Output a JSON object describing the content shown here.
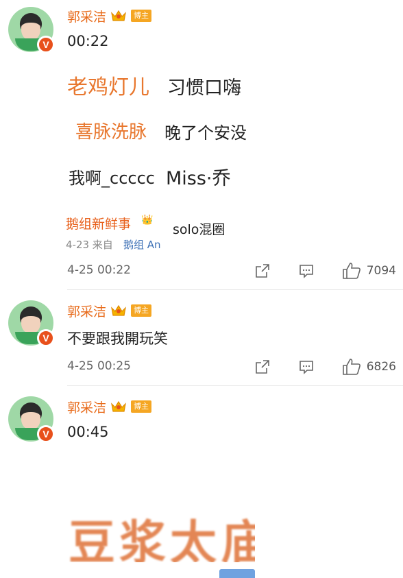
{
  "posts": [
    {
      "user": {
        "name": "郭采洁",
        "tag": "博主"
      },
      "text": "00:22",
      "embedded": {
        "line1_name": "老鸡灯儿",
        "line1_text": "习惯口嗨",
        "line2_name": "喜脉洗脉",
        "line2_text": "晚了个安没",
        "line3_left": "我啊_ccccc",
        "line3_right": "Miss·乔",
        "line4_name": "鹅组新鲜事",
        "line4_right": "solo混圈",
        "line5_meta": "4-23  来自",
        "line5_source": "鹅组 An"
      },
      "timestamp": "4-25 00:22",
      "likes": "7094"
    },
    {
      "user": {
        "name": "郭采洁",
        "tag": "博主"
      },
      "text": "不要跟我開玩笑",
      "timestamp": "4-25 00:25",
      "likes": "6826"
    },
    {
      "user": {
        "name": "郭采洁",
        "tag": "博主"
      },
      "text": "00:45",
      "image_text": "豆浆太庙"
    }
  ],
  "colors": {
    "name": "#e86b1b",
    "tag": "#f5a623",
    "vbadge": "#e8501b"
  }
}
